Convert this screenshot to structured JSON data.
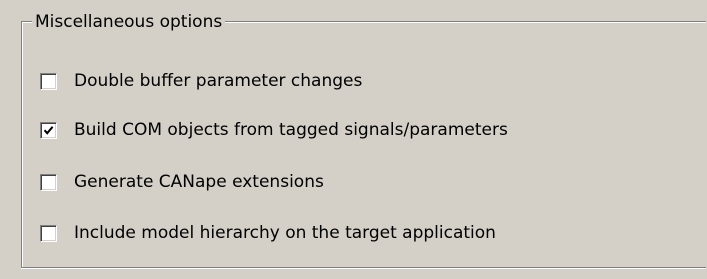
{
  "group": {
    "title": "Miscellaneous options"
  },
  "options": [
    {
      "label": "Double buffer parameter changes",
      "checked": false
    },
    {
      "label": "Build COM objects from tagged signals/parameters",
      "checked": true
    },
    {
      "label": "Generate CANape extensions",
      "checked": false
    },
    {
      "label": "Include model hierarchy on the target application",
      "checked": false
    }
  ]
}
